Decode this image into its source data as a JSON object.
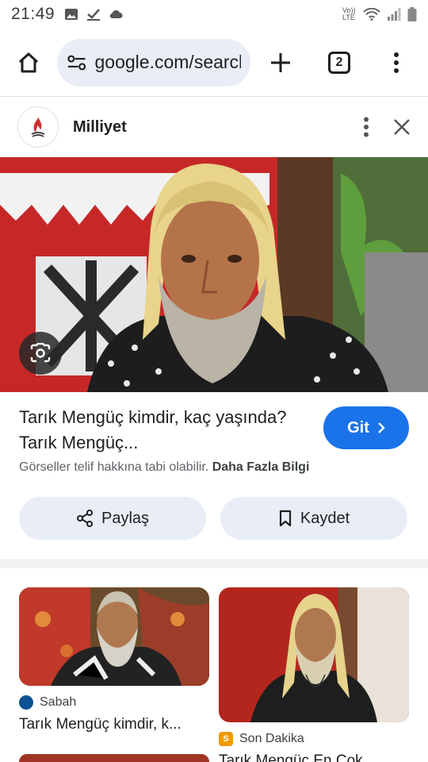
{
  "status_bar": {
    "time": "21:49",
    "left_icons": [
      "image-icon",
      "check-icon",
      "cloud-icon"
    ],
    "right_icons": [
      "volte-icon",
      "wifi-icon",
      "signal-icon",
      "battery-icon"
    ],
    "volte_text": "Vo)) LTE"
  },
  "toolbar": {
    "url": "google.com/search",
    "tab_count": "2"
  },
  "source": {
    "name": "Milliyet"
  },
  "result": {
    "title": "Tarık Mengüç kimdir, kaç yaşında? Tarık Mengüç...",
    "go_label": "Git",
    "notice_text": "Görseller telif hakkına tabi olabilir.",
    "notice_link": "Daha Fazla Bilgi",
    "share_label": "Paylaş",
    "save_label": "Kaydet"
  },
  "related": [
    {
      "source": "Sabah",
      "title": "Tarık Mengüç kimdir, k..."
    },
    {
      "source": "Son Dakika",
      "title": "Tarık Mengüç En Çok..."
    }
  ],
  "colors": {
    "accent": "#1a73e8",
    "chip_bg": "#e9eef6",
    "sabah_badge": "#0b5394",
    "sondakika_badge": "#f29900"
  }
}
